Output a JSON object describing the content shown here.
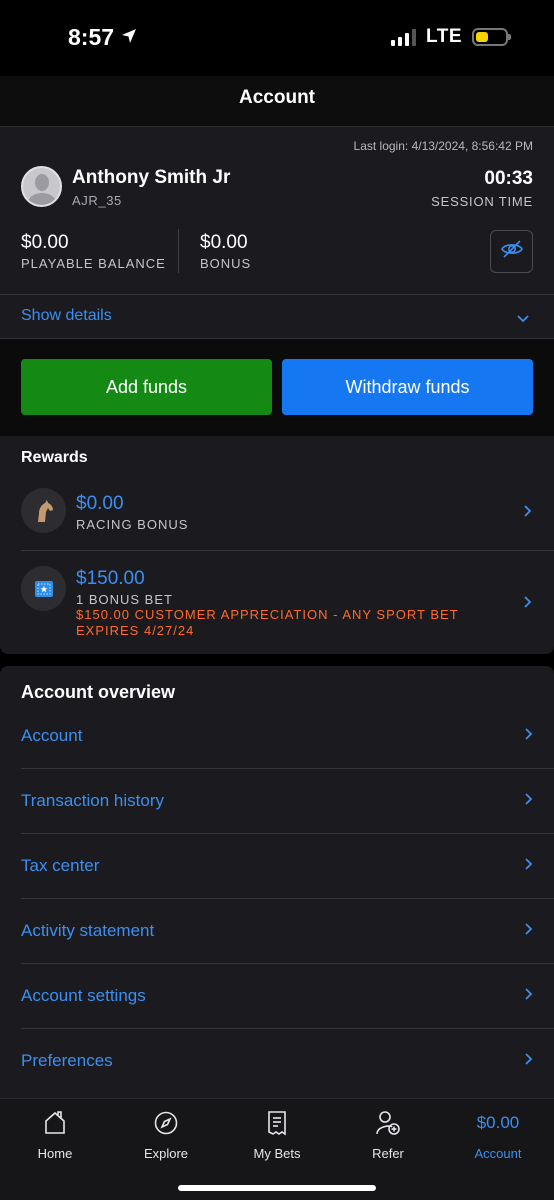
{
  "status_bar": {
    "time": "8:57",
    "network": "LTE",
    "icons": [
      "location-arrow-icon",
      "cellular-signal-icon",
      "battery-icon"
    ]
  },
  "header": {
    "title": "Account"
  },
  "account": {
    "last_login": "Last login: 4/13/2024, 8:56:42 PM",
    "name": "Anthony Smith Jr",
    "username": "AJR_35",
    "session_time": "00:33",
    "session_label": "SESSION TIME",
    "playable_balance": "$0.00",
    "playable_label": "PLAYABLE BALANCE",
    "bonus": "$0.00",
    "bonus_label": "BONUS",
    "show_details": "Show details"
  },
  "actions": {
    "add_funds": "Add funds",
    "withdraw_funds": "Withdraw funds"
  },
  "rewards": {
    "title": "Rewards",
    "items": [
      {
        "amount": "$0.00",
        "label": "RACING BONUS",
        "icon": "horse-icon"
      },
      {
        "amount": "$150.00",
        "label": "1 BONUS BET",
        "promo": "$150.00 CUSTOMER APPRECIATION - ANY SPORT BET EXPIRES 4/27/24",
        "icon": "ticket-icon"
      }
    ]
  },
  "overview": {
    "title": "Account overview",
    "items": [
      "Account",
      "Transaction history",
      "Tax center",
      "Activity statement",
      "Account settings",
      "Preferences"
    ]
  },
  "tabbar": {
    "home": "Home",
    "explore": "Explore",
    "my_bets": "My Bets",
    "refer": "Refer",
    "account_amount": "$0.00",
    "account": "Account"
  },
  "colors": {
    "accent": "#3d8ef0",
    "add_funds": "#148a14",
    "withdraw": "#1677f2",
    "promo": "#ff6a2b"
  }
}
